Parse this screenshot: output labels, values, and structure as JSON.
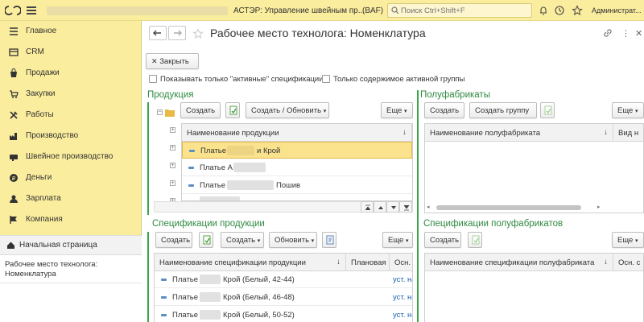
{
  "topbar": {
    "title": "АСТЭР: Управление швейным пр...",
    "db": "(BAF)",
    "search_placeholder": "Поиск Ctrl+Shift+F",
    "user": "Администрат..."
  },
  "sidebar": {
    "items": [
      {
        "label": "Главное",
        "icon": "menu-lines-icon"
      },
      {
        "label": "CRM",
        "icon": "crm-icon"
      },
      {
        "label": "Продажи",
        "icon": "sales-icon"
      },
      {
        "label": "Закупки",
        "icon": "purchase-icon"
      },
      {
        "label": "Работы",
        "icon": "tools-icon"
      },
      {
        "label": "Производство",
        "icon": "factory-icon"
      },
      {
        "label": "Швейное производство",
        "icon": "sewing-icon"
      },
      {
        "label": "Деньги",
        "icon": "money-icon"
      },
      {
        "label": "Зарплата",
        "icon": "salary-icon"
      },
      {
        "label": "Компания",
        "icon": "flag-icon"
      }
    ],
    "home_label": "Начальная страница",
    "open_window_label": "Рабочее место технолога: Номенклатура"
  },
  "page": {
    "title": "Рабочее место технолога: Номенклатура",
    "close_label": "Закрыть",
    "active_specs_label": "Показывать только \"активные\" спецификации",
    "active_group_label": "Только содержимое активной группы"
  },
  "products": {
    "title": "Продукция",
    "create_label": "Создать",
    "create_update_label": "Создать / Обновить",
    "more_label": "Еще",
    "column": "Наименование продукции",
    "rows": [
      {
        "prefix": "Платье",
        "suffix": "и Крой"
      },
      {
        "prefix": "Платье А",
        "suffix": ""
      },
      {
        "prefix": "Платье",
        "suffix": "Пошив"
      },
      {
        "prefix": "",
        "suffix": ""
      }
    ]
  },
  "semi": {
    "title": "Полуфабрикаты",
    "create_label": "Создать",
    "create_group_label": "Создать группу",
    "more_label": "Еще",
    "col_name": "Наименование полуфабриката",
    "col_kind": "Вид н"
  },
  "specs": {
    "title": "Спецификации продукции",
    "create_label": "Создать",
    "create2_label": "Создать",
    "update_label": "Обновить",
    "more_label": "Еще",
    "col_name": "Наименование спецификации продукции",
    "col_planned": "Плановая",
    "col_main": "Осн. с",
    "rows": [
      {
        "prefix": "Платье",
        "suffix": "Крой (Белый, 42-44)",
        "link": "уст. на"
      },
      {
        "prefix": "Платье",
        "suffix": "Крой (Белый, 46-48)",
        "link": "уст. на"
      },
      {
        "prefix": "Платье",
        "suffix": "Крой (Белый, 50-52)",
        "link": "уст. на"
      }
    ]
  },
  "semi_specs": {
    "title": "Спецификации полуфабрикатов",
    "create_label": "Создать",
    "more_label": "Еще",
    "col_name": "Наименование спецификации полуфабриката",
    "col_main": "Осн. с"
  },
  "colors": {
    "accent_yellow": "#fbed9e",
    "section_green": "#2f8a3f",
    "selected_row": "#fbe38e",
    "link_blue": "#1b5fb0"
  }
}
